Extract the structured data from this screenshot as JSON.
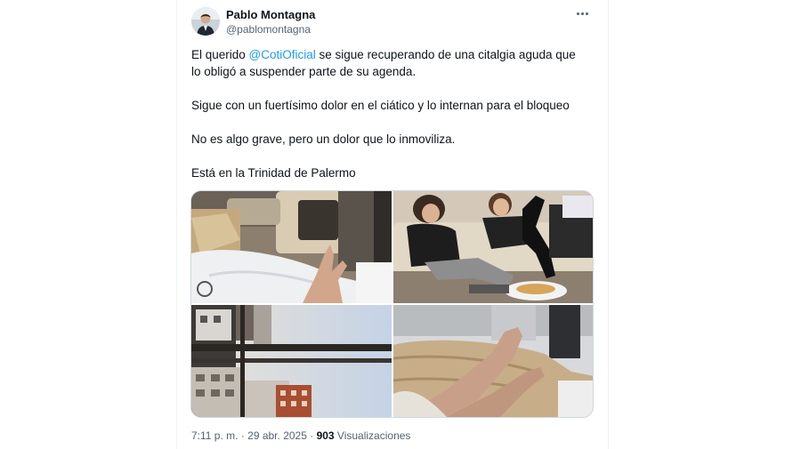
{
  "author": {
    "name": "Pablo Montagna",
    "handle": "@pablomontagna",
    "avatar_icon": "profile-photo"
  },
  "tweet": {
    "line1_before": "El querido ",
    "mention": "@CotiOficial",
    "line1_after": " se sigue recuperando de una citalgia aguda que",
    "line2": "lo obligó a suspender parte de su agenda.",
    "para2": "Sigue con un fuertísimo dolor en el ciático y lo internan para el bloqueo",
    "para3": "No es algo grave, pero un dolor que lo  inmoviliza.",
    "para4": "Está en la Trinidad de Palermo"
  },
  "media": {
    "photos": [
      "hospital-room-hand-gesture-photo",
      "two-women-on-sofa-photo",
      "window-city-buildings-photo",
      "legs-on-hospital-bed-photo"
    ]
  },
  "meta": {
    "time": "7:11 p. m.",
    "sep1": " · ",
    "date": "29 abr. 2025",
    "sep2": " · ",
    "views_count": "903",
    "views_label": " Visualizaciones"
  },
  "colors": {
    "link": "#1d9bf0",
    "secondary_text": "#536471",
    "primary_text": "#0f1419"
  }
}
